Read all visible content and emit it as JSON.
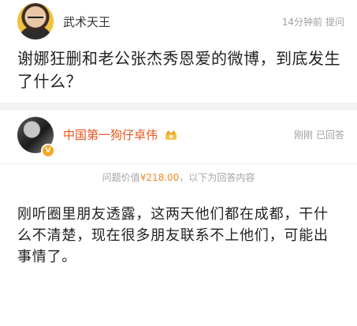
{
  "question": {
    "username": "武术天王",
    "time": "14分钟前",
    "action": "提问",
    "title": "谢娜狂删和老公张杰秀恩爱的微博，到底发生了什么？"
  },
  "answer": {
    "username": "中国第一狗仔卓伟",
    "badge_icon": "crown-icon",
    "verified_icon": "verified-v-icon",
    "time": "刚刚",
    "status": "已回答",
    "bounty_prefix": "问题价值",
    "bounty_amount": "¥218.00",
    "bounty_suffix": "，以下为回答内容",
    "body": "刚听圈里朋友透露，这两天他们都在成都，干什么不清楚，现在很多朋友联系不上他们，可能出事情了。",
    "colors": {
      "username": "#e8541d",
      "amount": "#f08a24"
    }
  }
}
